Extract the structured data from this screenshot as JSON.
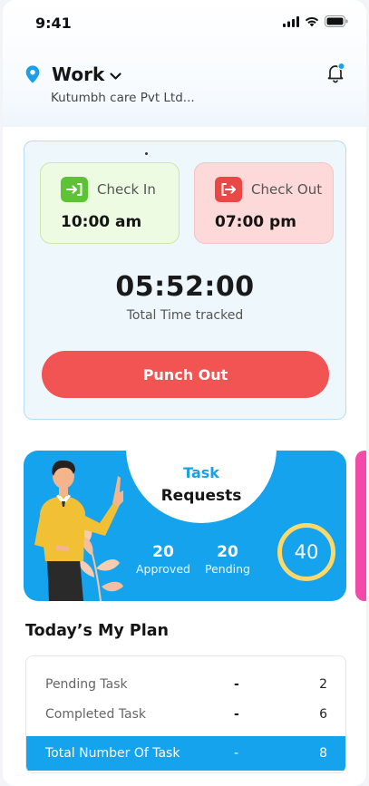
{
  "status_bar": {
    "time": "9:41"
  },
  "location": {
    "title": "Work",
    "company": "Kutumbh care Pvt Ltd..."
  },
  "attendance": {
    "check_in": {
      "label": "Check In",
      "time": "10:00 am"
    },
    "check_out": {
      "label": "Check Out",
      "time": "07:00 pm"
    },
    "tracked_time": "05:52:00",
    "tracked_label": "Total Time tracked",
    "punch_button": "Punch Out"
  },
  "task_requests": {
    "title_line1": "Task",
    "title_line2": "Requests",
    "approved": {
      "value": "20",
      "label": "Approved"
    },
    "pending": {
      "value": "20",
      "label": "Pending"
    },
    "total": "40"
  },
  "plan": {
    "title": "Today’s  My Plan",
    "rows": [
      {
        "name": "Pending Task",
        "dash": "-",
        "value": "2"
      },
      {
        "name": "Completed Task",
        "dash": "-",
        "value": "6"
      }
    ],
    "total": {
      "name": "Total Number Of Task",
      "dash": "-",
      "value": "8"
    }
  },
  "colors": {
    "accent": "#16a3ee",
    "danger": "#f25454",
    "success": "#5cc334",
    "ring": "#ffd86a",
    "peek_card": "#f24aa8"
  }
}
